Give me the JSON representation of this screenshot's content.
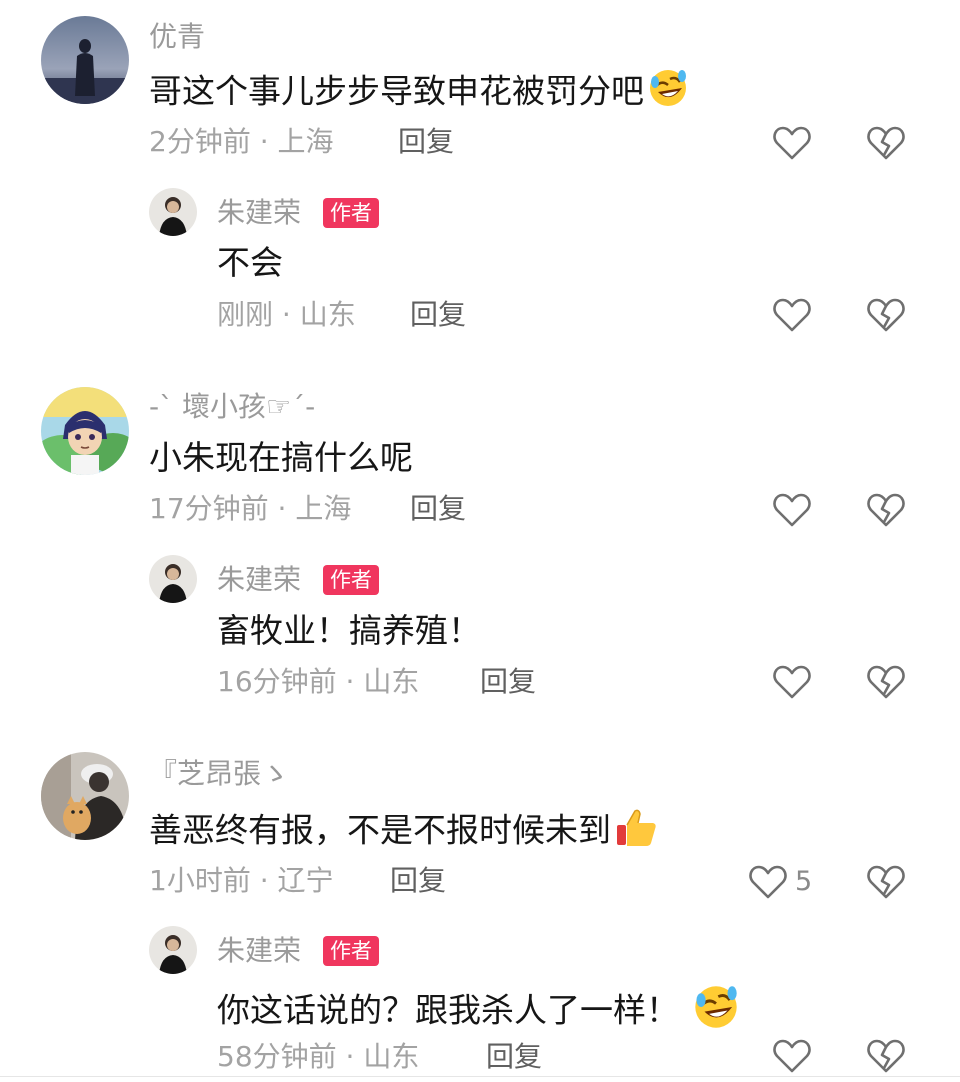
{
  "colors": {
    "username": "#9a9a9a",
    "meta": "#a3a3a3",
    "reply": "#606060",
    "author_badge_bg": "#f0365e",
    "icon_stroke": "#6f6f6f"
  },
  "threads": [
    {
      "comment": {
        "user": "优青",
        "text": "哥这个事儿步步导致申花被罚分吧",
        "emoji": "rolling-on-floor-laughing-emoji",
        "time": "2分钟前",
        "location": "上海",
        "reply_label": "回复",
        "like_count": "",
        "avatar": "dusk-silhouette-avatar"
      },
      "reply": {
        "user": "朱建荣",
        "badge": "作者",
        "text": "不会",
        "time": "刚刚",
        "location": "山东",
        "reply_label": "回复"
      }
    },
    {
      "comment": {
        "user": "-ˋ 壞小孩☞ˊ-",
        "text": "小朱现在搞什么呢",
        "time": "17分钟前",
        "location": "上海",
        "reply_label": "回复",
        "like_count": "",
        "avatar": "anime-character-avatar"
      },
      "reply": {
        "user": "朱建荣",
        "badge": "作者",
        "text": "畜牧业！搞养殖！",
        "time": "16分钟前",
        "location": "山东",
        "reply_label": "回复"
      }
    },
    {
      "comment": {
        "user": "『芝昂張ゝ",
        "text": "善恶终有报，不是不报时候未到",
        "emoji": "thumbs-up-emoji",
        "time": "1小时前",
        "location": "辽宁",
        "reply_label": "回复",
        "like_count": "5",
        "avatar": "person-with-cat-avatar"
      },
      "reply": {
        "user": "朱建荣",
        "badge": "作者",
        "text": "你这话说的？跟我杀人了一样！",
        "emoji": "rolling-on-floor-laughing-emoji",
        "time": "58分钟前",
        "location": "山东",
        "reply_label": "回复"
      }
    }
  ],
  "separator": " · "
}
